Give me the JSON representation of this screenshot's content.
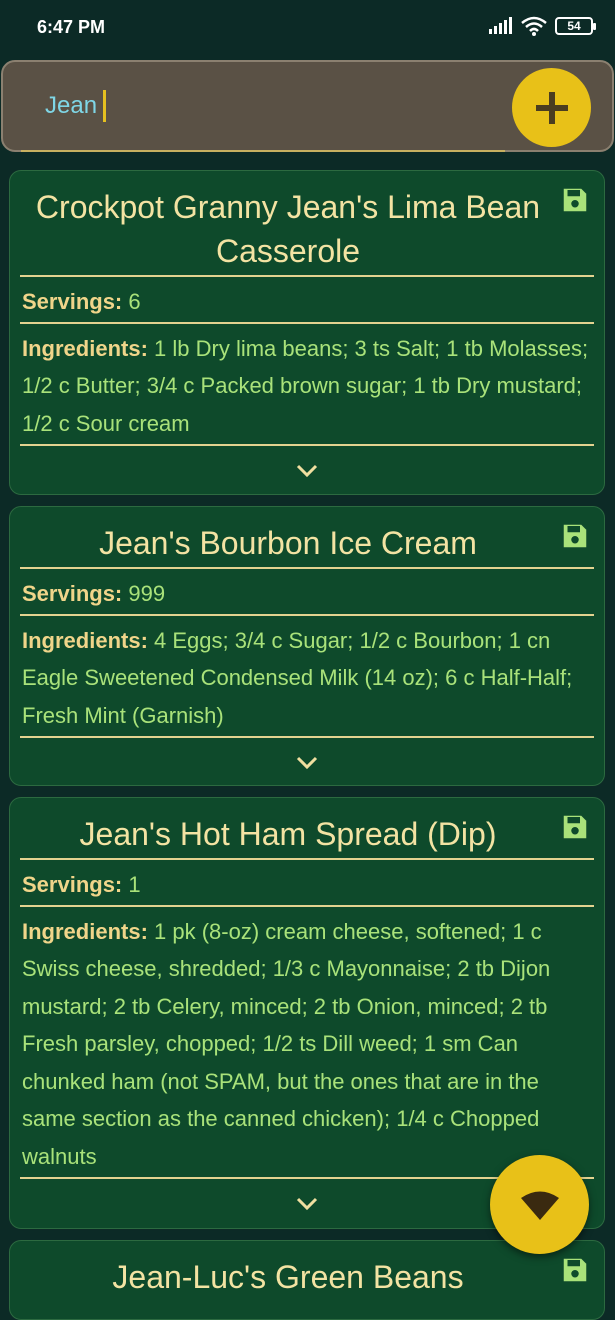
{
  "status_bar": {
    "time": "6:47 PM",
    "battery": "54"
  },
  "search": {
    "value": "Jean",
    "placeholder": ""
  },
  "recipes": [
    {
      "title": "Crockpot Granny Jean's Lima Bean Casserole",
      "servings_label": "Servings:",
      "servings": "6",
      "ingredients_label": "Ingredients:",
      "ingredients": "1 lb Dry lima beans; 3 ts Salt; 1 tb Molasses; 1/2 c Butter; 3/4 c Packed brown sugar; 1 tb Dry mustard; 1/2 c Sour cream"
    },
    {
      "title": "Jean's Bourbon Ice Cream",
      "servings_label": "Servings:",
      "servings": "999",
      "ingredients_label": "Ingredients:",
      "ingredients": "4 Eggs; 3/4 c Sugar; 1/2 c Bourbon; 1 cn Eagle Sweetened Condensed Milk (14 oz); 6 c Half-Half; Fresh Mint (Garnish)"
    },
    {
      "title": "Jean's Hot Ham Spread (Dip)",
      "servings_label": "Servings:",
      "servings": "1",
      "ingredients_label": "Ingredients:",
      "ingredients": "1 pk (8-oz) cream cheese, softened; 1 c Swiss cheese, shredded; 1/3 c Mayonnaise; 2 tb Dijon mustard; 2 tb Celery, minced; 2 tb Onion, minced; 2 tb Fresh parsley, chopped; 1/2 ts Dill weed; 1 sm Can chunked ham (not SPAM, but the ones that are in the same section as the canned chicken); 1/4 c Chopped walnuts"
    },
    {
      "title": "Jean-Luc's Green Beans"
    }
  ],
  "colors": {
    "background": "#0c2a26",
    "card": "#0e4a2b",
    "accent": "#e8c118",
    "title_text": "#f3e3a3",
    "value_text": "#a9e27a"
  },
  "icons": {
    "add": "plus-icon",
    "save": "floppy-disk-icon",
    "expand": "chevron-down-icon",
    "fab": "wifi-icon"
  }
}
